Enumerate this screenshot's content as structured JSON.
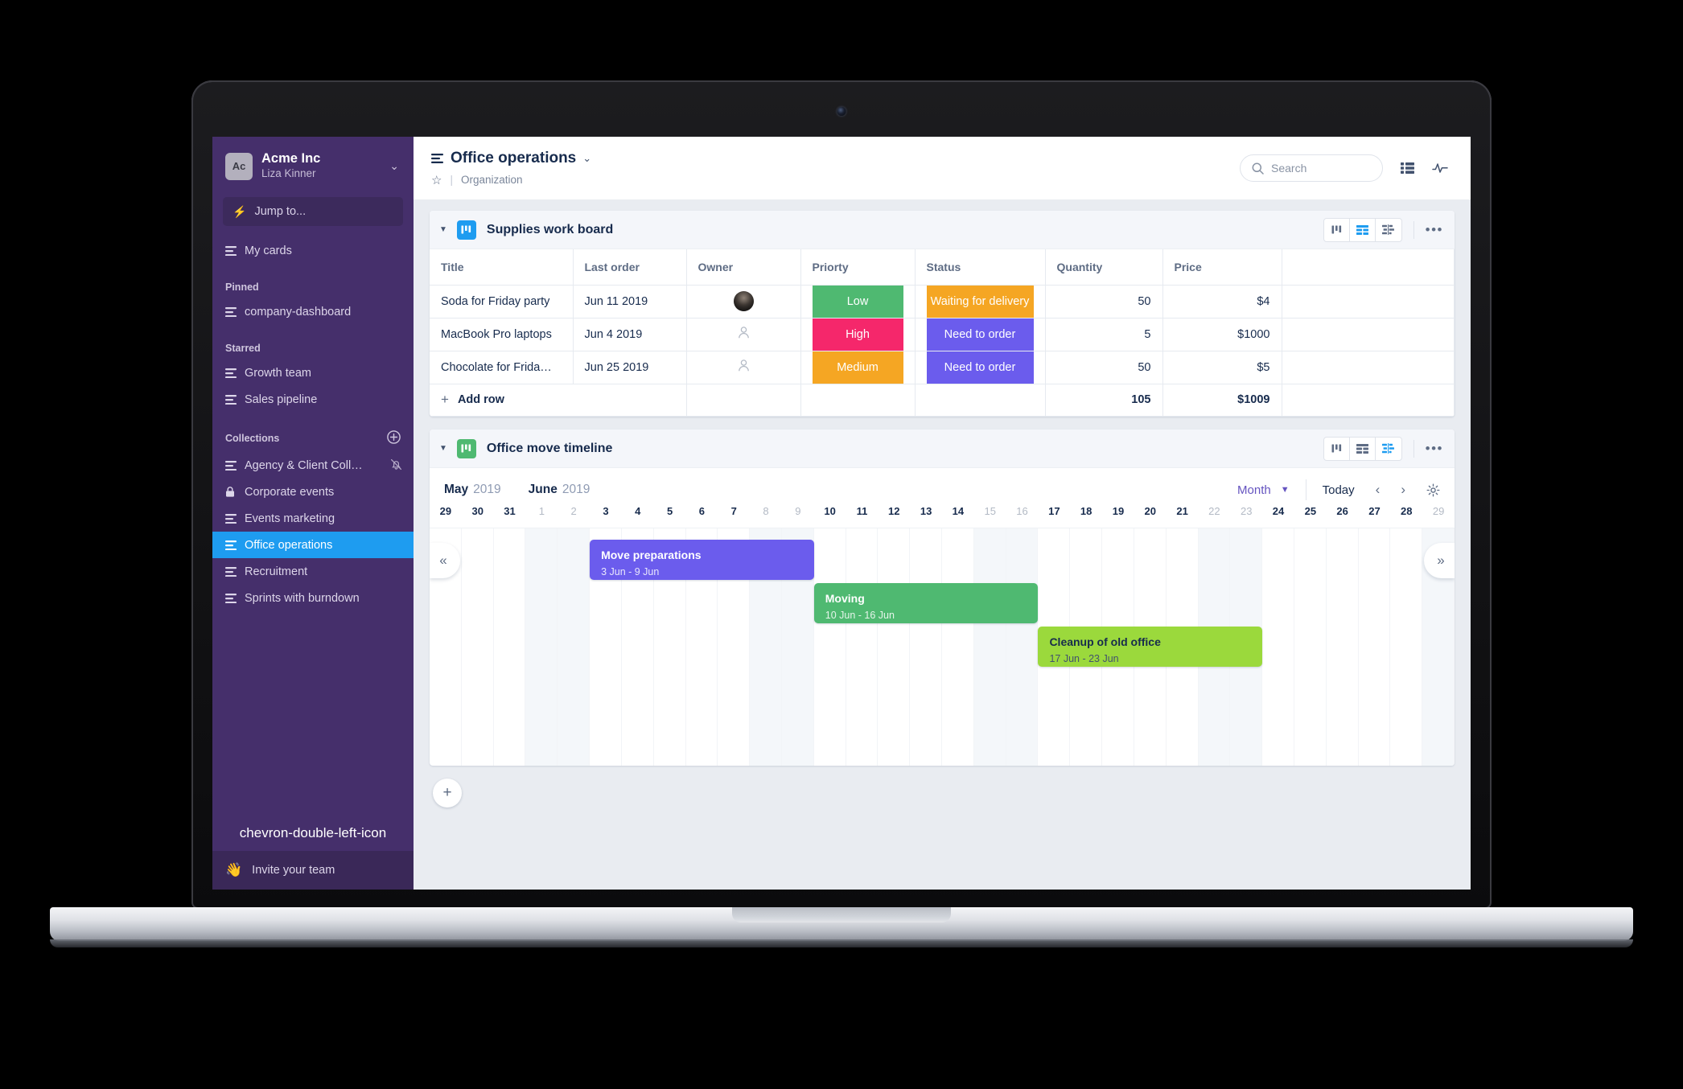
{
  "sidebar": {
    "org": {
      "avatar_initials": "Ac",
      "name": "Acme Inc",
      "user": "Liza Kinner",
      "caret": "⌄"
    },
    "jump_to": {
      "label": "Jump to...",
      "icon": "bolt-icon"
    },
    "my_cards": {
      "label": "My cards"
    },
    "sections": {
      "pinned": "Pinned",
      "starred": "Starred",
      "collections": "Collections"
    },
    "pinned_items": [
      {
        "label": "company-dashboard",
        "icon": "board-icon"
      }
    ],
    "starred_items": [
      {
        "label": "Growth team",
        "icon": "board-icon"
      },
      {
        "label": "Sales pipeline",
        "icon": "board-icon"
      }
    ],
    "collection_items": [
      {
        "label": "Agency & Client Coll…",
        "icon": "board-icon",
        "trailing_icon": "bell-muted-icon",
        "active": false
      },
      {
        "label": "Corporate events",
        "icon": "lock-icon",
        "active": false
      },
      {
        "label": "Events marketing",
        "icon": "board-icon",
        "active": false
      },
      {
        "label": "Office operations",
        "icon": "board-icon",
        "active": true
      },
      {
        "label": "Recruitment",
        "icon": "board-icon",
        "active": false
      },
      {
        "label": "Sprints with burndown",
        "icon": "board-icon",
        "active": false
      }
    ],
    "collapse": {
      "icon": "chevron-double-left-icon"
    },
    "invite": {
      "label": "Invite your team",
      "emoji": "👋"
    },
    "colors": {
      "bg": "#452f6b",
      "active": "#1e9cf0",
      "footer": "#3a2858"
    }
  },
  "topbar": {
    "title": "Office operations",
    "title_caret": "⌄",
    "breadcrumb": "Organization",
    "search_placeholder": "Search",
    "icons": [
      "list-view-icon",
      "activity-icon"
    ]
  },
  "boards": [
    {
      "title": "Supplies work board",
      "badge_color": "#1e9cf0",
      "active_view": 1,
      "columns": [
        "Title",
        "Last order",
        "Owner",
        "Priorty",
        "Status",
        "Quantity",
        "Price"
      ],
      "rows": [
        {
          "title": "Soda for Friday party",
          "last_order": "Jun 11 2019",
          "owner": "avatar-photo",
          "priority": {
            "label": "Low",
            "color": "#4fb971"
          },
          "status": {
            "label": "Waiting for delivery",
            "color": "#f5a623"
          },
          "quantity": "50",
          "price": "$4"
        },
        {
          "title": "MacBook Pro laptops",
          "last_order": "Jun 4 2019",
          "owner": "avatar-placeholder",
          "priority": {
            "label": "High",
            "color": "#f5276b"
          },
          "status": {
            "label": "Need to order",
            "color": "#6b5ced"
          },
          "quantity": "5",
          "price": "$1000"
        },
        {
          "title": "Chocolate for Frida…",
          "last_order": "Jun 25 2019",
          "owner": "avatar-placeholder",
          "priority": {
            "label": "Medium",
            "color": "#f5a623"
          },
          "status": {
            "label": "Need to order",
            "color": "#6b5ced"
          },
          "quantity": "50",
          "price": "$5"
        }
      ],
      "totals": {
        "quantity": "105",
        "price": "$1009"
      },
      "add_row_label": "Add row"
    },
    {
      "title": "Office move timeline",
      "badge_color": "#4fb971",
      "active_view": 2,
      "toolbar": {
        "months": [
          {
            "name": "May",
            "year": "2019"
          },
          {
            "name": "June",
            "year": "2019"
          }
        ],
        "zoom_level": "Month",
        "today_label": "Today",
        "prev": "‹",
        "next": "›",
        "settings_icon": "gear-icon"
      },
      "days": [
        {
          "n": "29",
          "weekend": false
        },
        {
          "n": "30",
          "weekend": false
        },
        {
          "n": "31",
          "weekend": false
        },
        {
          "n": "1",
          "weekend": true
        },
        {
          "n": "2",
          "weekend": true
        },
        {
          "n": "3",
          "weekend": false
        },
        {
          "n": "4",
          "weekend": false
        },
        {
          "n": "5",
          "weekend": false
        },
        {
          "n": "6",
          "weekend": false
        },
        {
          "n": "7",
          "weekend": false
        },
        {
          "n": "8",
          "weekend": true
        },
        {
          "n": "9",
          "weekend": true
        },
        {
          "n": "10",
          "weekend": false
        },
        {
          "n": "11",
          "weekend": false
        },
        {
          "n": "12",
          "weekend": false
        },
        {
          "n": "13",
          "weekend": false
        },
        {
          "n": "14",
          "weekend": false
        },
        {
          "n": "15",
          "weekend": true
        },
        {
          "n": "16",
          "weekend": true
        },
        {
          "n": "17",
          "weekend": false
        },
        {
          "n": "18",
          "weekend": false
        },
        {
          "n": "19",
          "weekend": false
        },
        {
          "n": "20",
          "weekend": false
        },
        {
          "n": "21",
          "weekend": false
        },
        {
          "n": "22",
          "weekend": true
        },
        {
          "n": "23",
          "weekend": true
        },
        {
          "n": "24",
          "weekend": false
        },
        {
          "n": "25",
          "weekend": false
        },
        {
          "n": "26",
          "weekend": false
        },
        {
          "n": "27",
          "weekend": false
        },
        {
          "n": "28",
          "weekend": false
        },
        {
          "n": "29",
          "weekend": true
        }
      ],
      "bars": [
        {
          "title": "Move preparations",
          "dates": "3 Jun - 9 Jun",
          "color": "#6b5ced",
          "text": "dark",
          "start_index": 5,
          "span": 7,
          "row": 0
        },
        {
          "title": "Moving",
          "dates": "10 Jun - 16 Jun",
          "color": "#4fb971",
          "text": "dark",
          "start_index": 12,
          "span": 7,
          "row": 1
        },
        {
          "title": "Cleanup of old office",
          "dates": "17 Jun - 23 Jun",
          "color": "#9bd93c",
          "text": "light",
          "start_index": 19,
          "span": 7,
          "row": 2
        }
      ],
      "scroll_left": "«",
      "scroll_right": "»"
    }
  ],
  "add_board_button": {
    "label": "+"
  }
}
